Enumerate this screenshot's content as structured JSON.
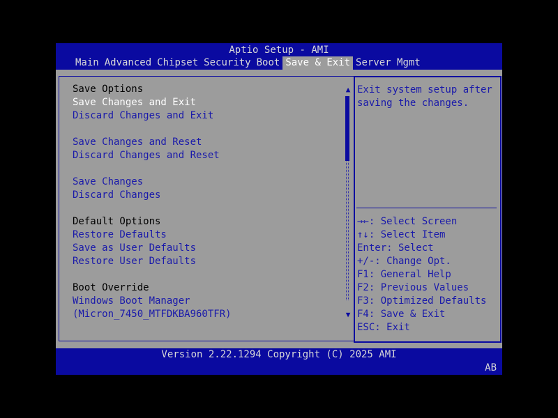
{
  "header": {
    "title": "Aptio Setup - AMI",
    "tabs": [
      {
        "label": "Main"
      },
      {
        "label": "Advanced"
      },
      {
        "label": "Chipset"
      },
      {
        "label": "Security"
      },
      {
        "label": "Boot"
      },
      {
        "label": "Save & Exit",
        "active": true
      },
      {
        "label": "Server Mgmt"
      }
    ]
  },
  "menu": {
    "items": [
      {
        "label": "Save Options",
        "type": "heading"
      },
      {
        "label": "Save Changes and Exit",
        "type": "item",
        "selected": true
      },
      {
        "label": "Discard Changes and Exit",
        "type": "item"
      },
      {
        "label": "Save Changes and Reset",
        "type": "item"
      },
      {
        "label": "Discard Changes and Reset",
        "type": "item"
      },
      {
        "label": "Save Changes",
        "type": "item"
      },
      {
        "label": "Discard Changes",
        "type": "item"
      },
      {
        "label": "Default Options",
        "type": "heading"
      },
      {
        "label": "Restore Defaults",
        "type": "item"
      },
      {
        "label": "Save as User Defaults",
        "type": "item"
      },
      {
        "label": "Restore User Defaults",
        "type": "item"
      },
      {
        "label": "Boot Override",
        "type": "heading"
      },
      {
        "label": "Windows Boot Manager",
        "type": "item"
      },
      {
        "label": "(Micron_7450_MTFDKBA960TFR)",
        "type": "item"
      }
    ]
  },
  "help": {
    "text": "Exit system setup after saving the changes.",
    "keys": [
      "→←: Select Screen",
      "↑↓: Select Item",
      "Enter: Select",
      "+/-: Change Opt.",
      "F1: General Help",
      "F2: Previous Values",
      "F3: Optimized Defaults",
      "F4: Save & Exit",
      "ESC: Exit"
    ]
  },
  "footer": {
    "version": "Version 2.22.1294 Copyright (C) 2025 AMI",
    "code": "AB"
  },
  "colors": {
    "bar": "#0a0aa0",
    "panel": "#9c9c9c",
    "item_text": "#1a1aaa",
    "selected_text": "#ffffff"
  }
}
